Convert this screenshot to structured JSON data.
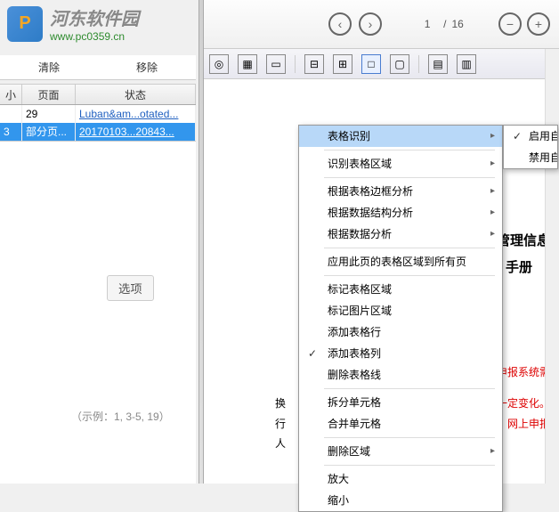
{
  "watermark": {
    "title": "河东软件园",
    "url": "www.pc0359.cn"
  },
  "toolbar_left": {
    "clear": "清除",
    "remove": "移除"
  },
  "table": {
    "headers": {
      "col1": "小",
      "col2": "页面",
      "col3": "状态"
    },
    "rows": [
      {
        "c1": "",
        "c2": "29",
        "c3": "Luban&am...otated..."
      },
      {
        "c1": "3",
        "c2": "部分页...",
        "c3": "20170103...20843..."
      }
    ]
  },
  "options_btn": "选项",
  "example_text": "（示例：1, 3-5, 19）",
  "nav": {
    "page_current": "1",
    "page_sep": "/",
    "page_total": "16"
  },
  "document": {
    "line1": "管理信息",
    "line2": "手册",
    "red1": "申报系统需",
    "red2": "一定变化。",
    "red3": "网上申报",
    "black1": "换",
    "black2": "行",
    "black3": "人"
  },
  "context_menu": {
    "items": [
      {
        "label": "表格识别",
        "sub": true,
        "hl": true
      },
      {
        "label": "识别表格区域",
        "sub": true
      },
      {
        "label": "根据表格边框分析",
        "sub": true
      },
      {
        "label": "根据数据结构分析",
        "sub": true
      },
      {
        "label": "根据数据分析",
        "sub": true
      },
      {
        "label": "应用此页的表格区域到所有页"
      },
      {
        "label": "标记表格区域"
      },
      {
        "label": "标记图片区域"
      },
      {
        "label": "添加表格行"
      },
      {
        "label": "添加表格列",
        "checked": true
      },
      {
        "label": "删除表格线"
      },
      {
        "label": "拆分单元格"
      },
      {
        "label": "合并单元格"
      },
      {
        "label": "删除区域",
        "sub": true
      },
      {
        "label": "放大"
      },
      {
        "label": "缩小"
      }
    ]
  },
  "submenu": {
    "items": [
      {
        "label": "启用自",
        "checked": true
      },
      {
        "label": "禁用自"
      }
    ]
  }
}
